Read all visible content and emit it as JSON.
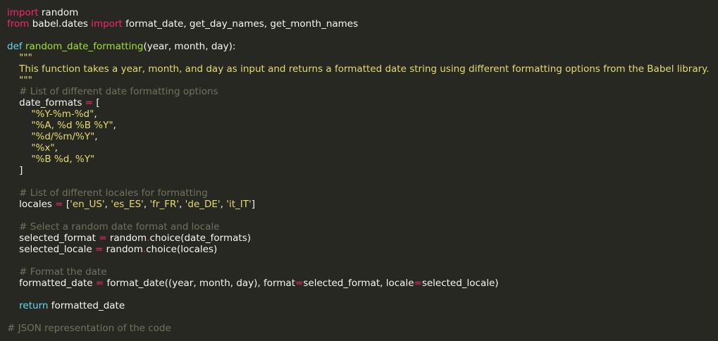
{
  "colors": {
    "background": "#272822",
    "plain": "#f8f8f2",
    "keyword": "#f92672",
    "string": "#e6db74",
    "comment": "#75715e",
    "function_name": "#a6e22e",
    "storage": "#66d9ef"
  },
  "code": {
    "lines": [
      [
        {
          "t": "import",
          "c": "kw"
        },
        {
          "t": " random",
          "c": "pl"
        }
      ],
      [
        {
          "t": "from",
          "c": "kw"
        },
        {
          "t": " babel.dates ",
          "c": "pl"
        },
        {
          "t": "import",
          "c": "kw"
        },
        {
          "t": " format_date, get_day_names, get_month_names",
          "c": "pl"
        }
      ],
      [],
      [
        {
          "t": "def",
          "c": "bi"
        },
        {
          "t": " ",
          "c": "pl"
        },
        {
          "t": "random_date_formatting",
          "c": "fn"
        },
        {
          "t": "(year, month, day):",
          "c": "pl"
        }
      ],
      [
        {
          "t": "    \"\"\"",
          "c": "st"
        }
      ],
      [
        {
          "t": "    This function takes a year, month, and day as input and returns a formatted date string using different formatting options from the Babel library.",
          "c": "st"
        }
      ],
      [
        {
          "t": "    \"\"\"",
          "c": "st"
        }
      ],
      [
        {
          "t": "    # List of different date formatting options",
          "c": "cm"
        }
      ],
      [
        {
          "t": "    date_formats ",
          "c": "pl"
        },
        {
          "t": "=",
          "c": "op"
        },
        {
          "t": " [",
          "c": "pl"
        }
      ],
      [
        {
          "t": "        \"%Y-%m-%d\"",
          "c": "st"
        },
        {
          "t": ",",
          "c": "pl"
        }
      ],
      [
        {
          "t": "        \"%A, %d %B %Y\"",
          "c": "st"
        },
        {
          "t": ",",
          "c": "pl"
        }
      ],
      [
        {
          "t": "        \"%d/%m/%Y\"",
          "c": "st"
        },
        {
          "t": ",",
          "c": "pl"
        }
      ],
      [
        {
          "t": "        \"%x\"",
          "c": "st"
        },
        {
          "t": ",",
          "c": "pl"
        }
      ],
      [
        {
          "t": "        \"%B %d, %Y\"",
          "c": "st"
        }
      ],
      [
        {
          "t": "    ]",
          "c": "pl"
        }
      ],
      [],
      [
        {
          "t": "    # List of different locales for formatting",
          "c": "cm"
        }
      ],
      [
        {
          "t": "    locales ",
          "c": "pl"
        },
        {
          "t": "=",
          "c": "op"
        },
        {
          "t": " [",
          "c": "pl"
        },
        {
          "t": "'en_US'",
          "c": "st"
        },
        {
          "t": ", ",
          "c": "pl"
        },
        {
          "t": "'es_ES'",
          "c": "st"
        },
        {
          "t": ", ",
          "c": "pl"
        },
        {
          "t": "'fr_FR'",
          "c": "st"
        },
        {
          "t": ", ",
          "c": "pl"
        },
        {
          "t": "'de_DE'",
          "c": "st"
        },
        {
          "t": ", ",
          "c": "pl"
        },
        {
          "t": "'it_IT'",
          "c": "st"
        },
        {
          "t": "]",
          "c": "pl"
        }
      ],
      [],
      [
        {
          "t": "    # Select a random date format and locale",
          "c": "cm"
        }
      ],
      [
        {
          "t": "    selected_format ",
          "c": "pl"
        },
        {
          "t": "=",
          "c": "op"
        },
        {
          "t": " random",
          "c": "pl"
        },
        {
          "t": ".",
          "c": "op"
        },
        {
          "t": "choice(date_formats)",
          "c": "pl"
        }
      ],
      [
        {
          "t": "    selected_locale ",
          "c": "pl"
        },
        {
          "t": "=",
          "c": "op"
        },
        {
          "t": " random",
          "c": "pl"
        },
        {
          "t": ".",
          "c": "op"
        },
        {
          "t": "choice(locales)",
          "c": "pl"
        }
      ],
      [],
      [
        {
          "t": "    # Format the date",
          "c": "cm"
        }
      ],
      [
        {
          "t": "    formatted_date ",
          "c": "pl"
        },
        {
          "t": "=",
          "c": "op"
        },
        {
          "t": " format_date((year, month, day), format",
          "c": "pl"
        },
        {
          "t": "=",
          "c": "op"
        },
        {
          "t": "selected_format, locale",
          "c": "pl"
        },
        {
          "t": "=",
          "c": "op"
        },
        {
          "t": "selected_locale)",
          "c": "pl"
        }
      ],
      [],
      [
        {
          "t": "    ",
          "c": "pl"
        },
        {
          "t": "return",
          "c": "bi"
        },
        {
          "t": " formatted_date",
          "c": "pl"
        }
      ],
      [],
      [
        {
          "t": "# JSON representation of the code",
          "c": "cm"
        }
      ]
    ]
  }
}
